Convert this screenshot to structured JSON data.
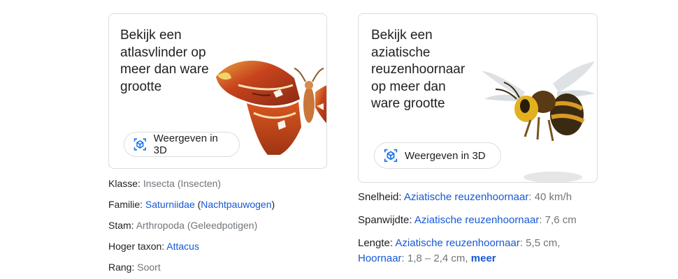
{
  "left_card": {
    "title": "Bekijk een\natlasvlinder op\nmeer dan ware\ngrootte",
    "button_label": "Weergeven in 3D"
  },
  "right_card": {
    "title": "Bekijk een\naziatische\nreuzenhoornaar\nop meer dan\nware grootte",
    "button_label": "Weergeven in 3D"
  },
  "left_facts": {
    "klasse": {
      "key": "Klasse: ",
      "value": "Insecta (Insecten)"
    },
    "familie": {
      "key": "Familie: ",
      "link1": "Saturniidae",
      "sep1": " (",
      "link2": "Nachtpauwogen",
      "sep2": ")"
    },
    "stam": {
      "key": "Stam: ",
      "value": "Arthropoda (Geleedpotigen)"
    },
    "hoger_taxon": {
      "key": "Hoger taxon: ",
      "link": "Attacus"
    },
    "rang": {
      "key": "Rang: ",
      "value": "Soort"
    }
  },
  "right_facts": {
    "snelheid": {
      "key": "Snelheid: ",
      "link": "Aziatische reuzenhoornaar",
      "value": ": 40 km/h"
    },
    "spanwijdte": {
      "key": "Spanwijdte: ",
      "link": "Aziatische reuzenhoornaar",
      "value": ": 7,6 cm"
    },
    "lengte": {
      "key": "Lengte: ",
      "link": "Aziatische reuzenhoornaar",
      "value": ": 5,5 cm,",
      "link2": "Hoornaar",
      "value2": ": 1,8 – 2,4 cm, ",
      "more": "meer"
    }
  },
  "colors": {
    "link": "#1558d6",
    "muted": "#70757a",
    "icon_blue": "#1a73e8"
  }
}
